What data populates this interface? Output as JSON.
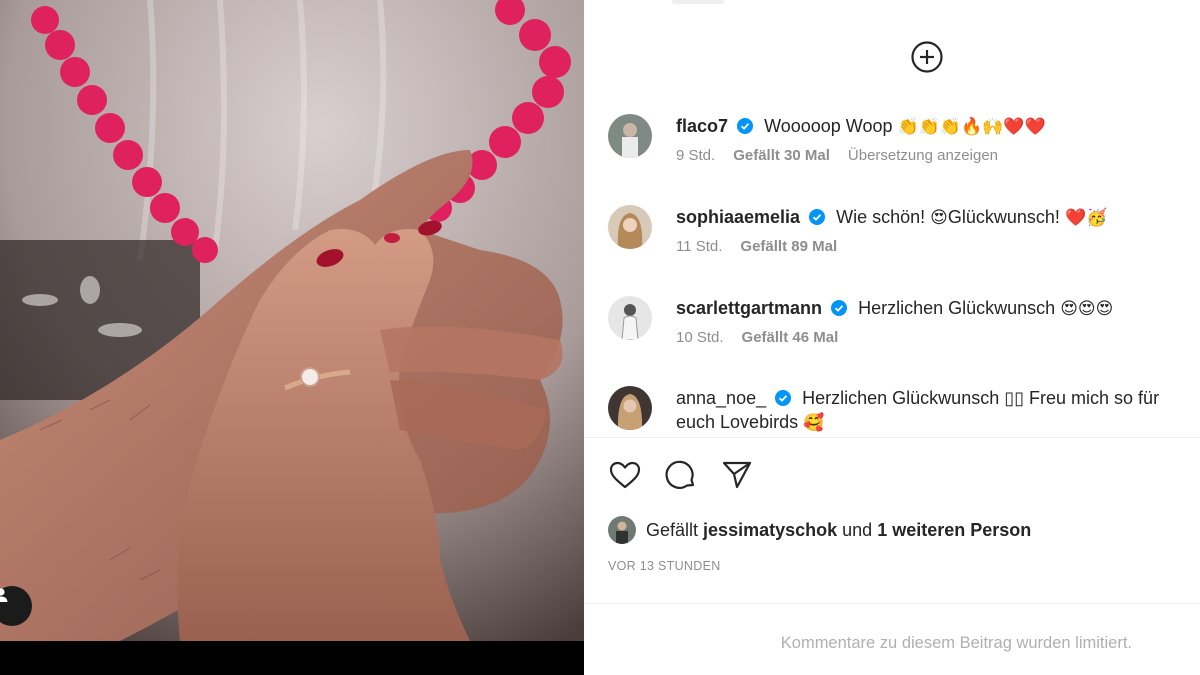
{
  "photo": {
    "description_icon": "user-tag-icon"
  },
  "panel": {
    "load_more_icon": "plus-circle-icon",
    "comments": [
      {
        "username": "flaco7",
        "text": "Wooooop Woop",
        "emoji": "👏👏👏🔥🙌❤️❤️",
        "time": "9 Std.",
        "likes": "Gefällt 30 Mal",
        "translate": "Übersetzung anzeigen"
      },
      {
        "username": "sophiaaemelia",
        "text": "Wie schön!",
        "emoji_1": "😍",
        "text_2": "Glückwunsch!",
        "emoji_2": "❤️🥳",
        "time": "11 Std.",
        "likes": "Gefällt 89 Mal"
      },
      {
        "username": "scarlettgartmann",
        "text": "Herzlichen Glückwunsch",
        "emoji": "😍😍😍",
        "time": "10 Std.",
        "likes": "Gefällt 46 Mal"
      },
      {
        "username": "anna_noe_",
        "text": "Herzlichen Glückwunsch ▯▯ Freu mich so für euch Lovebirds",
        "emoji": "🥰"
      }
    ],
    "actions": {
      "like_icon": "heart-icon",
      "comment_icon": "comment-icon",
      "share_icon": "send-icon"
    },
    "liked_by": {
      "prefix": "Gefällt",
      "user": "jessimatyschok",
      "middle": "und",
      "others": "1 weiteren Person"
    },
    "timestamp": "VOR 13 STUNDEN",
    "comments_limited": "Kommentare zu diesem Beitrag wurden limitiert."
  },
  "colors": {
    "verified_blue": "#0095f6",
    "meta_gray": "#8e8e8e",
    "balloon_pink": "#e0215f"
  }
}
